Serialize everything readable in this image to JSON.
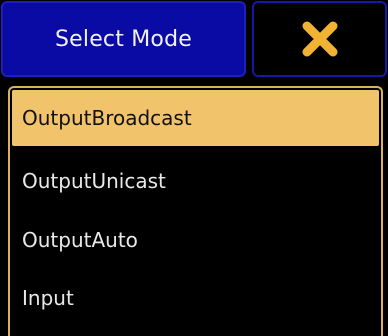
{
  "dialog": {
    "title": "Select Mode",
    "close_icon": "close-x-icon",
    "accent_color": "#f1c46c",
    "title_button_color": "#0a0aa4"
  },
  "options": {
    "selected": "OutputBroadcast",
    "items": [
      {
        "label": "OutputBroadcast"
      },
      {
        "label": "OutputUnicast"
      },
      {
        "label": "OutputAuto"
      },
      {
        "label": "Input"
      }
    ]
  }
}
